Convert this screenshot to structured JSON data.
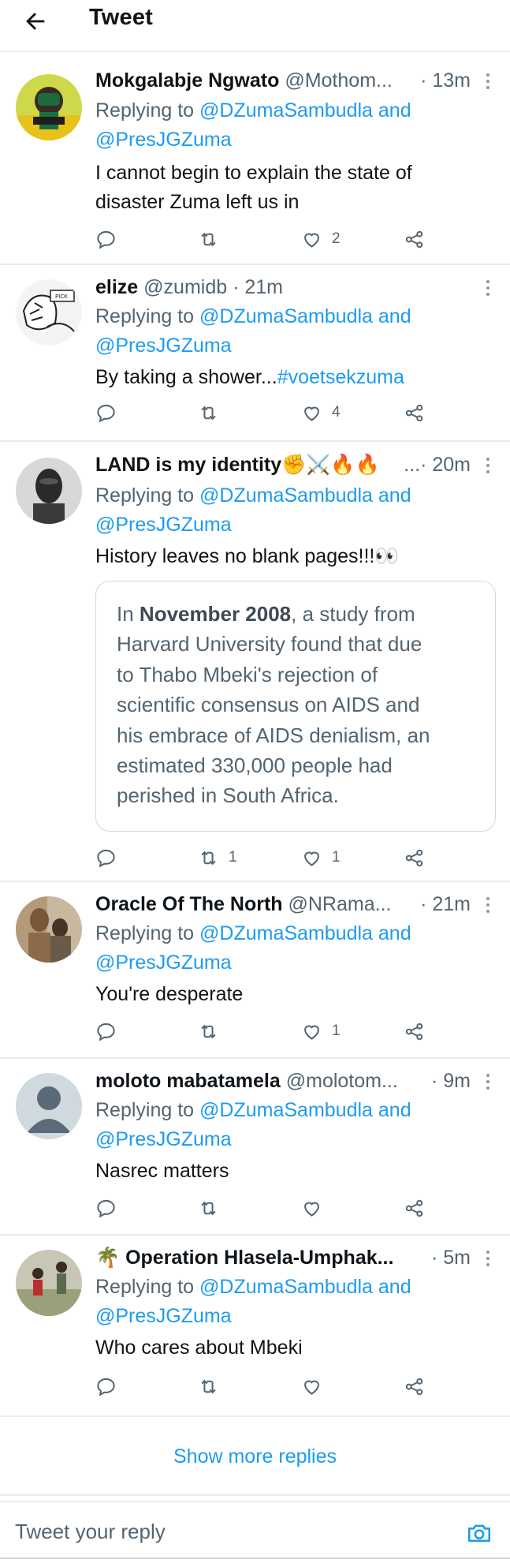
{
  "header": {
    "title": "Tweet",
    "back_icon": "arrow-left-icon"
  },
  "colors": {
    "accent": "#1d9bf0",
    "muted": "#536471",
    "divider": "#e7ecf0"
  },
  "tweets": [
    {
      "name": "Mokgalabje Ngwato",
      "handle": "@Mothom...",
      "time": "· 13m",
      "replying_label": "Replying to",
      "mention1": "@DZumaSambudla",
      "and_label": "and",
      "mention2": "@PresJGZuma",
      "text_lines": [
        "I cannot begin to explain the state of",
        "disaster Zuma left us in"
      ],
      "likes": "2",
      "retweets": ""
    },
    {
      "name": "elize",
      "handle": "@zumidb",
      "time": "· 21m",
      "replying_label": "Replying to",
      "mention1": "@DZumaSambudla",
      "and_label": "and",
      "mention2": "@PresJGZuma",
      "text": "By taking a shower...",
      "hashtag": "#voetsekzuma",
      "likes": "4",
      "retweets": ""
    },
    {
      "name": "LAND is my identity✊⚔️🔥🔥",
      "handle": "...",
      "time": "· 20m",
      "replying_label": "Replying to",
      "mention1": "@DZumaSambudla",
      "and_label": "and",
      "mention2": "@PresJGZuma",
      "text": "History leaves no blank pages!!!👀",
      "quote": {
        "prefix": "In ",
        "bold": "November 2008",
        "lines": [
          ", a study from",
          "Harvard University found that due",
          "to Thabo Mbeki's rejection of",
          "scientific consensus on AIDS and",
          "his embrace of AIDS denialism, an",
          "estimated 330,000 people had",
          "perished in South Africa."
        ]
      },
      "likes": "1",
      "retweets": "1"
    },
    {
      "name": "Oracle Of The North",
      "handle": "@NRama...",
      "time": "· 21m",
      "replying_label": "Replying to",
      "mention1": "@DZumaSambudla",
      "and_label": "and",
      "mention2": "@PresJGZuma",
      "text": "You're desperate",
      "likes": "1",
      "retweets": ""
    },
    {
      "name": "moloto mabatamela",
      "handle": "@molotom...",
      "time": "· 9m",
      "replying_label": "Replying to",
      "mention1": "@DZumaSambudla",
      "and_label": "and",
      "mention2": "@PresJGZuma",
      "text": "Nasrec matters",
      "likes": "",
      "retweets": ""
    },
    {
      "name": "🌴 Operation Hlasela-Umphak...",
      "handle": "",
      "time": "· 5m",
      "replying_label": "Replying to",
      "mention1": "@DZumaSambudla",
      "and_label": "and",
      "mention2": "@PresJGZuma",
      "text": "Who cares about Mbeki",
      "likes": "",
      "retweets": ""
    }
  ],
  "show_more": "Show more replies",
  "reply_bar": {
    "placeholder": "Tweet your reply",
    "camera_icon": "camera-icon"
  }
}
